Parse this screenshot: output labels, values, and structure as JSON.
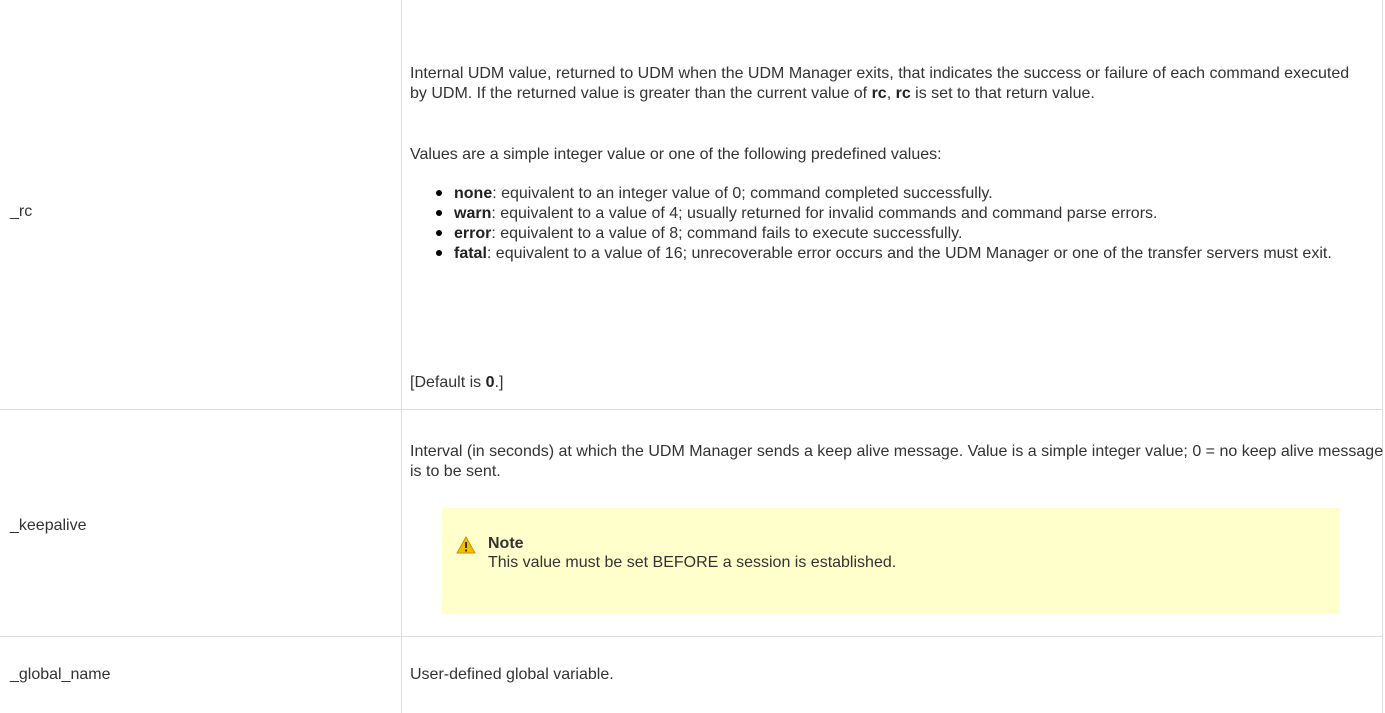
{
  "rows": [
    {
      "name": "_rc",
      "desc_p1_a": "Internal UDM value, returned to UDM when the UDM Manager exits, that indicates the success or failure of each command executed by UDM. If the returned value is greater than the current value of ",
      "desc_p1_b1": "rc",
      "desc_p1_c": ", ",
      "desc_p1_b2": "rc",
      "desc_p1_d": " is set to that return value.",
      "desc_p2": "Values are a simple integer value or one of the following predefined values:",
      "values": [
        {
          "term": "none",
          "text": ": equivalent to an integer value of 0; command completed successfully."
        },
        {
          "term": "warn",
          "text": ": equivalent to a value of 4; usually returned for invalid commands and command parse errors."
        },
        {
          "term": "error",
          "text": ": equivalent to a value of 8; command fails to execute successfully."
        },
        {
          "term": "fatal",
          "text": ": equivalent to a value of 16; unrecoverable error occurs and the UDM Manager or one of the transfer servers must exit."
        }
      ],
      "default_prefix": "[Default is ",
      "default_value": "0",
      "default_suffix": ".]"
    },
    {
      "name": "_keepalive",
      "desc": "Interval (in seconds) at which the UDM Manager sends a keep alive message. Value is a simple integer value; 0 = no keep alive message is to be sent.",
      "note_title": "Note",
      "note_text": "This value must be set BEFORE a session is established."
    },
    {
      "name": "_global_name",
      "desc": "User-defined global variable."
    }
  ],
  "colors": {
    "border": "#dddddd",
    "note_bg": "#ffffcc",
    "warning_icon": "#f0c000"
  },
  "icons": {
    "note": "warning-icon"
  }
}
